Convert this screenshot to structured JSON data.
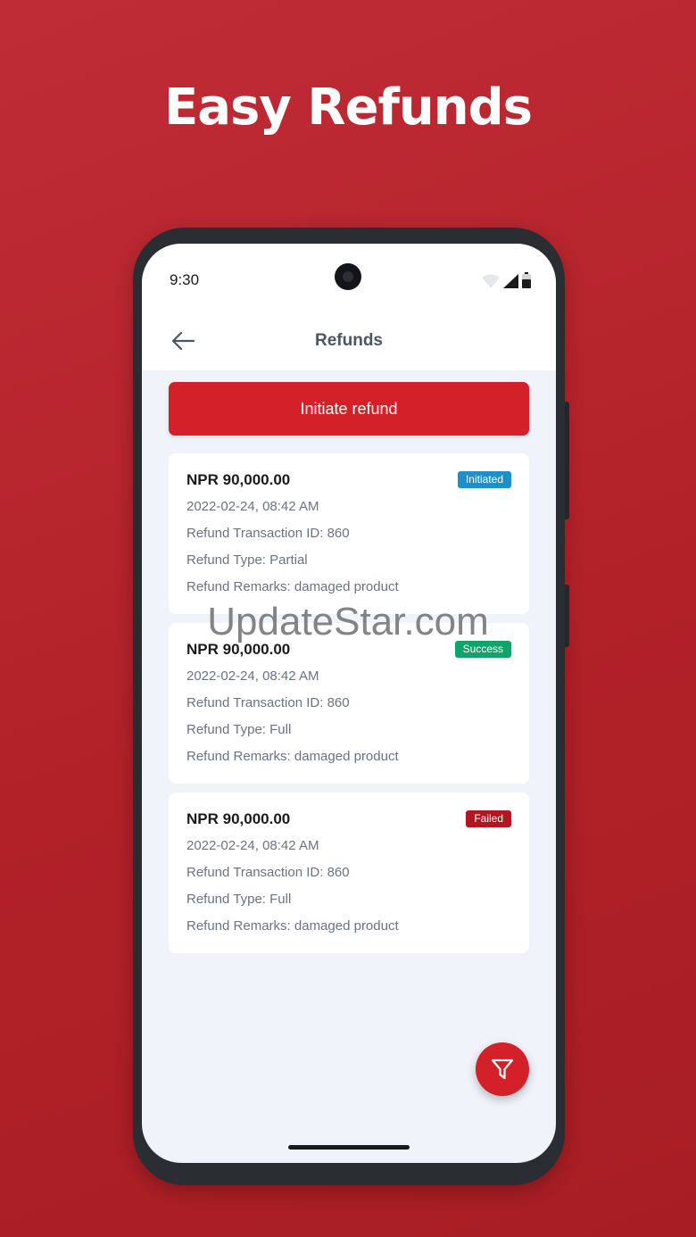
{
  "promo": {
    "headline": "Easy Refunds"
  },
  "status_bar": {
    "time": "9:30",
    "icons": [
      "wifi-icon",
      "signal-icon",
      "battery-icon"
    ]
  },
  "app_bar": {
    "title": "Refunds",
    "back_icon": "arrow-left-icon"
  },
  "actions": {
    "initiate_label": "Initiate refund",
    "filter_icon": "filter-icon"
  },
  "colors": {
    "brand_red": "#d32029",
    "status_initiated": "#1e8fc7",
    "status_success": "#12a36b",
    "status_failed": "#b3161e"
  },
  "refunds": [
    {
      "amount": "NPR 90,000.00",
      "status": "Initiated",
      "datetime": "2022-02-24, 08:42 AM",
      "transaction_id": "Refund Transaction ID: 860",
      "type": "Refund Type: Partial",
      "remarks": "Refund Remarks: damaged product"
    },
    {
      "amount": "NPR 90,000.00",
      "status": "Success",
      "datetime": "2022-02-24, 08:42 AM",
      "transaction_id": "Refund Transaction ID: 860",
      "type": "Refund Type: Full",
      "remarks": "Refund Remarks: damaged product"
    },
    {
      "amount": "NPR 90,000.00",
      "status": "Failed",
      "datetime": "2022-02-24, 08:42 AM",
      "transaction_id": "Refund Transaction ID: 860",
      "type": "Refund Type: Full",
      "remarks": "Refund Remarks: damaged product"
    }
  ],
  "watermark": "UpdateStar.com"
}
